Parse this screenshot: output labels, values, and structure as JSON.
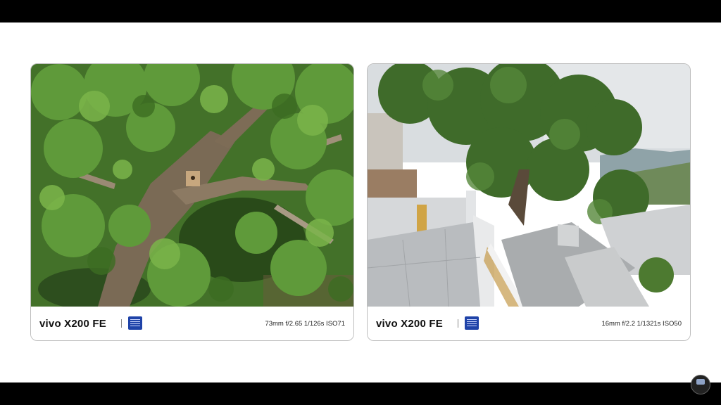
{
  "cards": [
    {
      "brand": "vivo X200 FE",
      "meta": "73mm  f/2.65  1/126s  ISO71"
    },
    {
      "brand": "vivo X200 FE",
      "meta": "16mm  f/2.2  1/1321s  ISO50"
    }
  ],
  "icons": {
    "zeiss_logo": "zeiss-logo-icon",
    "channel_watermark": "channel-watermark-icon"
  },
  "colors": {
    "zeiss_blue": "#1f43a8",
    "background": "#ffffff",
    "letterbox": "#000000"
  }
}
